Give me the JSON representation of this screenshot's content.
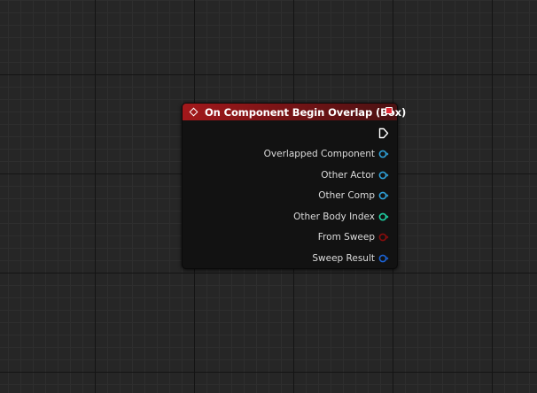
{
  "node": {
    "title": "On Component Begin Overlap (Box)",
    "header_color": "#a3181b",
    "icon": "event-icon",
    "delegate_pin_color": "#e62a36",
    "exec_pin": "exec-output-icon",
    "pins": [
      {
        "label": "Overlapped Component",
        "color": "#2f9fd6",
        "icon": "object-pin-icon"
      },
      {
        "label": "Other Actor",
        "color": "#2f9fd6",
        "icon": "object-pin-icon"
      },
      {
        "label": "Other Comp",
        "color": "#2f9fd6",
        "icon": "object-pin-icon"
      },
      {
        "label": "Other Body Index",
        "color": "#1fd3a4",
        "icon": "integer-pin-icon"
      },
      {
        "label": "From Sweep",
        "color": "#8c0c0c",
        "icon": "boolean-pin-icon"
      },
      {
        "label": "Sweep Result",
        "color": "#1b62d4",
        "icon": "struct-pin-icon"
      }
    ]
  }
}
